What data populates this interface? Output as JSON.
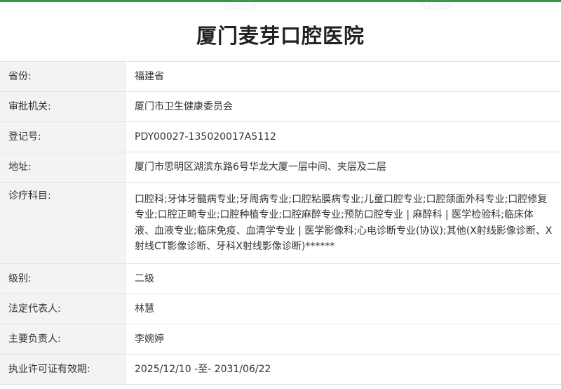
{
  "page": {
    "title": "厦门麦芽口腔医院"
  },
  "rows": [
    {
      "label": "省份:",
      "value": "福建省"
    },
    {
      "label": "审批机关:",
      "value": "厦门市卫生健康委员会"
    },
    {
      "label": "登记号:",
      "value": "PDY00027-135020017A5112"
    },
    {
      "label": "地址:",
      "value": "厦门市思明区湖滨东路6号华龙大厦一层中间、夹层及二层"
    },
    {
      "label": "诊疗科目:",
      "value": "口腔科;牙体牙髓病专业;牙周病专业;口腔粘膜病专业;儿童口腔专业;口腔颌面外科专业;口腔修复专业;口腔正畸专业;口腔种植专业;口腔麻醉专业;预防口腔专业 | 麻醉科 | 医学检验科;临床体液、血液专业;临床免疫、血清学专业 | 医学影像科;心电诊断专业(协议);其他(X射线影像诊断、X射线CT影像诊断、牙科X射线影像诊断)******"
    },
    {
      "label": "级别:",
      "value": "二级"
    },
    {
      "label": "法定代表人:",
      "value": "林慧"
    },
    {
      "label": "主要负责人:",
      "value": "李婉婷"
    },
    {
      "label": "执业许可证有效期:",
      "value": "2025/12/10 -至- 2031/06/22"
    }
  ],
  "colors": {
    "accent": "#2e9a4a",
    "label_bg": "#f3f3f3",
    "border": "#e2e2e2"
  }
}
